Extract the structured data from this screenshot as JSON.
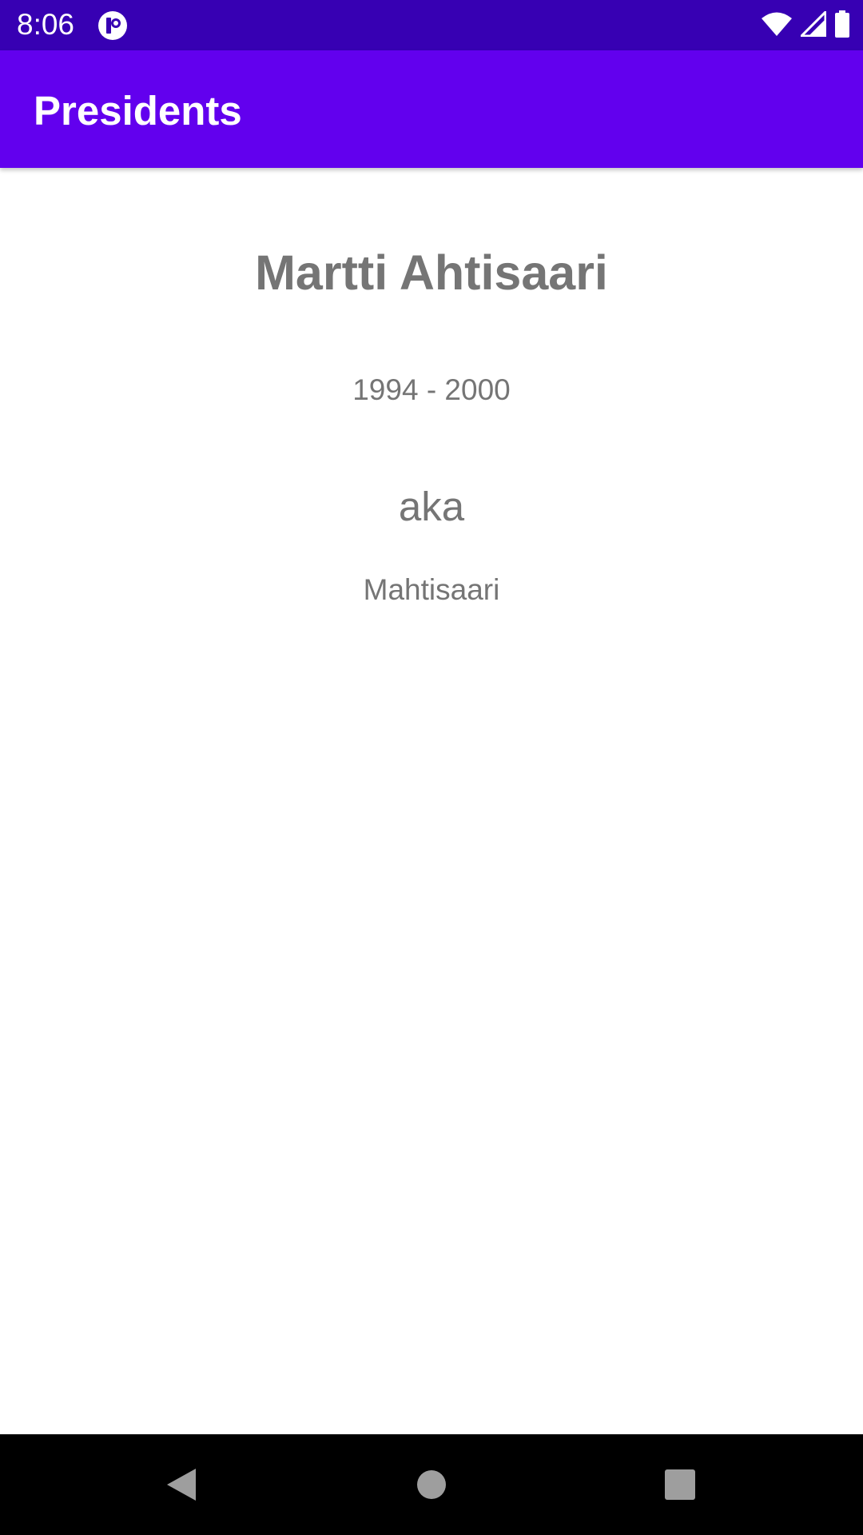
{
  "status_bar": {
    "time": "8:06",
    "icons": [
      "app-notification-icon",
      "wifi-icon",
      "cellular-signal-icon",
      "battery-icon"
    ]
  },
  "app_bar": {
    "title": "Presidents"
  },
  "detail": {
    "name": "Martti Ahtisaari",
    "years": "1994 - 2000",
    "aka_label": "aka",
    "nickname": "Mahtisaari"
  },
  "nav_bar": {
    "icons": [
      "back-icon",
      "home-icon",
      "recents-icon"
    ]
  },
  "colors": {
    "status_bar": "#3700B3",
    "app_bar": "#6200EE",
    "text_secondary": "#757575",
    "nav_bar": "#000000"
  }
}
